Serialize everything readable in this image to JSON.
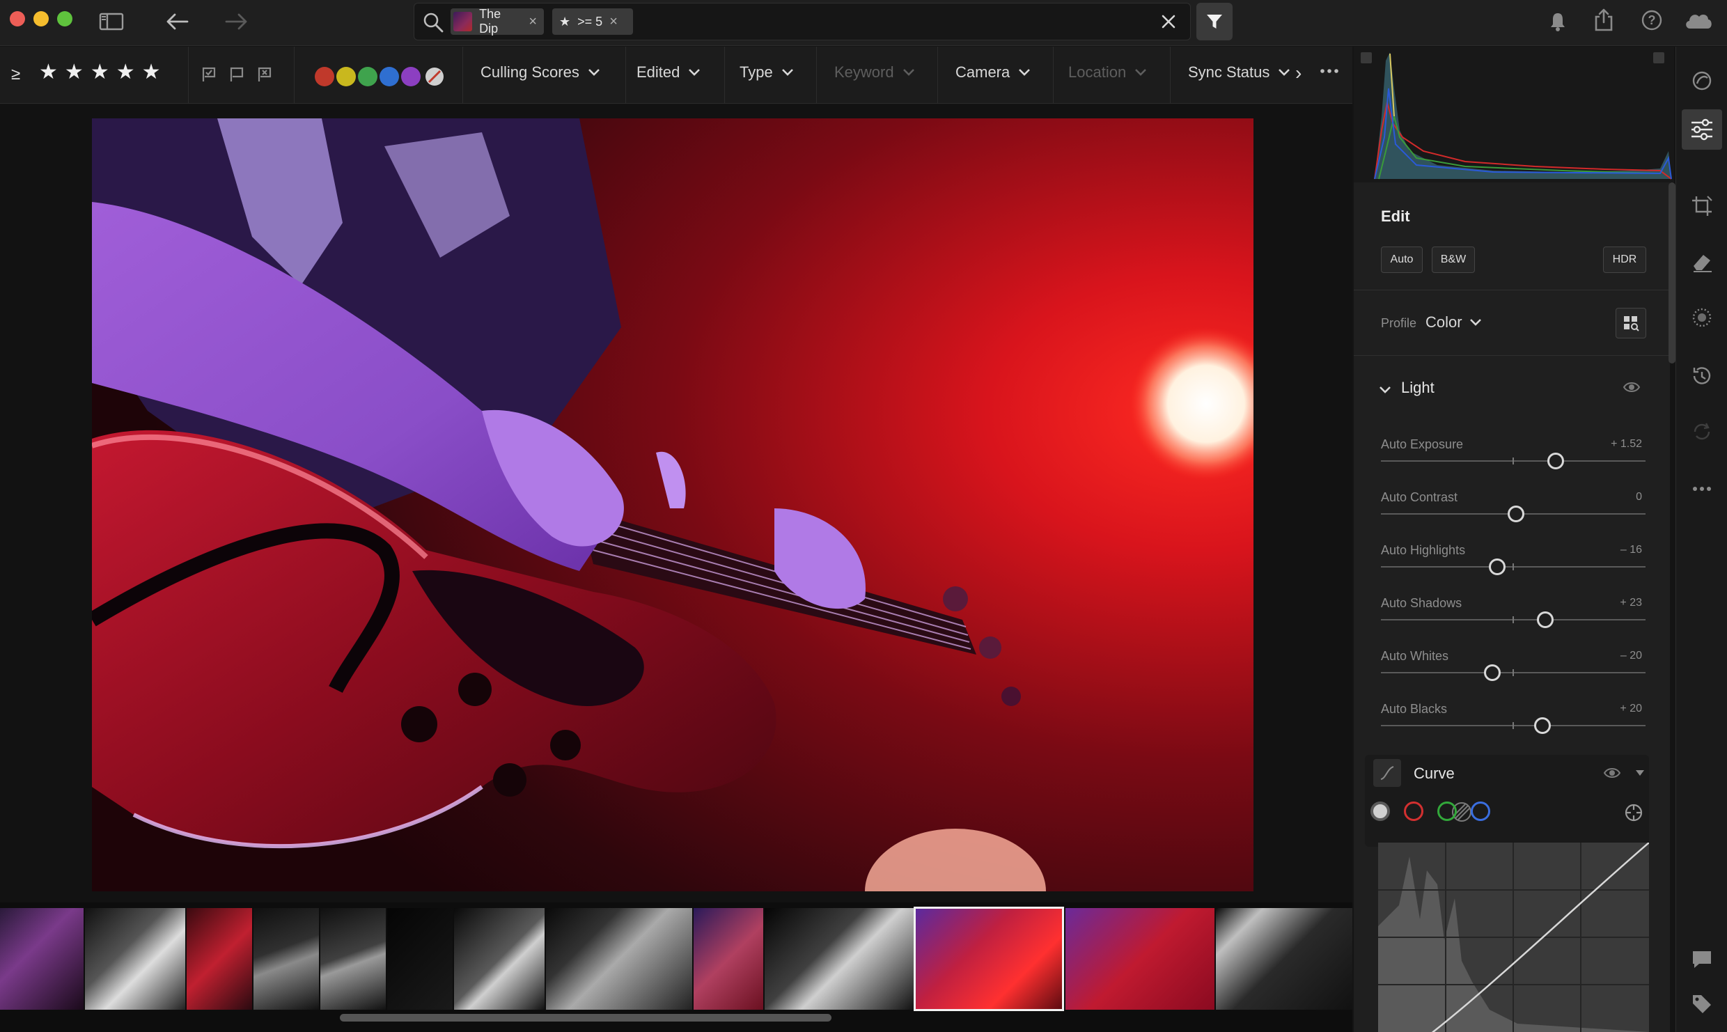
{
  "search": {
    "album_chip": "The Dip",
    "rating_chip": ">= 5",
    "clear_icon": "close-icon"
  },
  "filterbar": {
    "rating_compare": "≥",
    "stars": 5,
    "color_labels": [
      "#c0392b",
      "#c9b81e",
      "#3fa34d",
      "#2f6fd1",
      "#8c3fc1"
    ],
    "dropdowns": [
      {
        "label": "Culling Scores",
        "enabled": true
      },
      {
        "label": "Edited",
        "enabled": true
      },
      {
        "label": "Type",
        "enabled": true
      },
      {
        "label": "Keyword",
        "enabled": false
      },
      {
        "label": "Camera",
        "enabled": true
      },
      {
        "label": "Location",
        "enabled": false
      },
      {
        "label": "Sync Status",
        "enabled": true
      }
    ],
    "more_icon": "ellipsis-icon"
  },
  "edit_panel": {
    "title": "Edit",
    "auto_label": "Auto",
    "bw_label": "B&W",
    "hdr_label": "HDR",
    "profile_label": "Profile",
    "profile_value": "Color",
    "light_section": "Light",
    "sliders": [
      {
        "label": "Auto Exposure",
        "value": "+ 1.52",
        "position": 0.66
      },
      {
        "label": "Auto Contrast",
        "value": "0",
        "position": 0.51
      },
      {
        "label": "Auto Highlights",
        "value": "– 16",
        "position": 0.44
      },
      {
        "label": "Auto Shadows",
        "value": "+ 23",
        "position": 0.62
      },
      {
        "label": "Auto Whites",
        "value": "– 20",
        "position": 0.42
      },
      {
        "label": "Auto Blacks",
        "value": "+ 20",
        "position": 0.61
      }
    ],
    "curve_section": "Curve",
    "curve_channels": [
      "#d0d0d0",
      "#d23030",
      "#32a83a",
      "#3a6ee0"
    ]
  },
  "colors": {
    "accent": "#3a3a3a",
    "panel": "#1f1f1f",
    "background": "#141414"
  },
  "filmstrip": {
    "selected_index": 11,
    "thumb_count": 14
  }
}
